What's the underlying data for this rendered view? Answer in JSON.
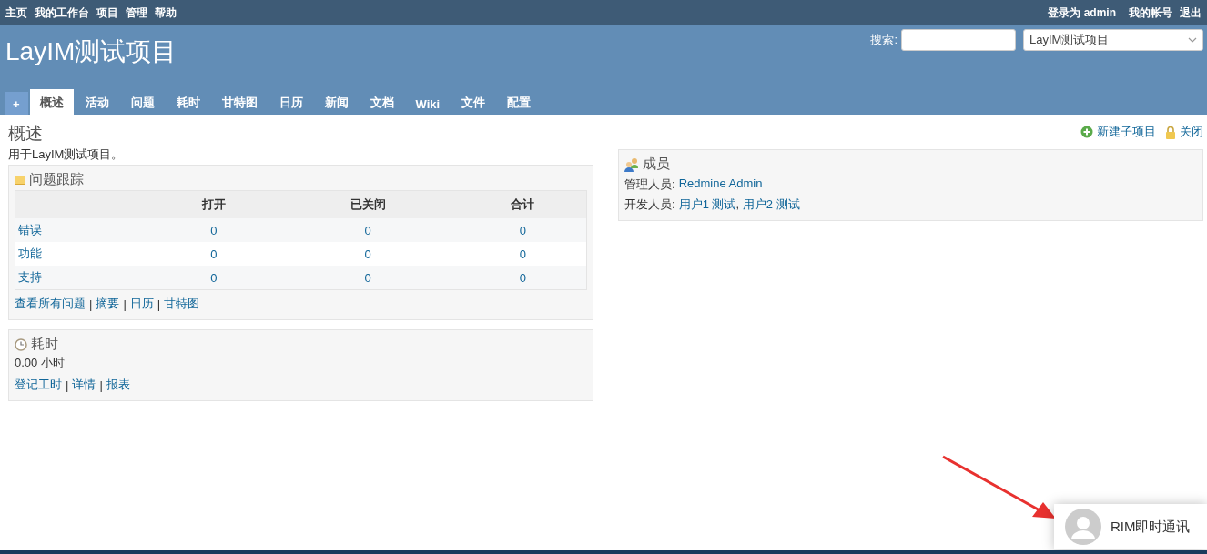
{
  "top_menu": {
    "left": [
      "主页",
      "我的工作台",
      "项目",
      "管理",
      "帮助"
    ],
    "logged_in": "登录为 admin",
    "right": [
      "我的帐号",
      "退出"
    ]
  },
  "header": {
    "title": "LayIM测试项目",
    "search_label": "搜索:",
    "project_select": "LayIM测试项目"
  },
  "tabs": [
    {
      "label": "+",
      "kind": "new",
      "selected": false
    },
    {
      "label": "概述",
      "kind": "tab",
      "selected": true
    },
    {
      "label": "活动",
      "kind": "tab",
      "selected": false
    },
    {
      "label": "问题",
      "kind": "tab",
      "selected": false
    },
    {
      "label": "耗时",
      "kind": "tab",
      "selected": false
    },
    {
      "label": "甘特图",
      "kind": "tab",
      "selected": false
    },
    {
      "label": "日历",
      "kind": "tab",
      "selected": false
    },
    {
      "label": "新闻",
      "kind": "tab",
      "selected": false
    },
    {
      "label": "文档",
      "kind": "tab",
      "selected": false
    },
    {
      "label": "Wiki",
      "kind": "tab",
      "selected": false
    },
    {
      "label": "文件",
      "kind": "tab",
      "selected": false
    },
    {
      "label": "配置",
      "kind": "tab",
      "selected": false
    }
  ],
  "page": {
    "title": "概述",
    "description": "用于LayIM测试项目。"
  },
  "actions": [
    {
      "label": "新建子项目",
      "kind": "add"
    },
    {
      "label": "关闭",
      "kind": "lock"
    }
  ],
  "issue_tracking": {
    "title": "问题跟踪",
    "columns": [
      "打开",
      "已关闭",
      "合计"
    ],
    "rows": [
      {
        "tracker": "错误",
        "values": [
          "0",
          "0",
          "0"
        ]
      },
      {
        "tracker": "功能",
        "values": [
          "0",
          "0",
          "0"
        ]
      },
      {
        "tracker": "支持",
        "values": [
          "0",
          "0",
          "0"
        ]
      }
    ],
    "links": [
      "查看所有问题",
      "摘要",
      "日历",
      "甘特图"
    ],
    "separator": "|"
  },
  "spent_time": {
    "title": "耗时",
    "value": "0.00 小时",
    "links": [
      "登记工时",
      "详情",
      "报表"
    ],
    "separator": "|"
  },
  "members": {
    "title": "成员",
    "groups": [
      {
        "role": "管理人员:",
        "users": [
          "Redmine Admin"
        ]
      },
      {
        "role": "开发人员:",
        "users": [
          "用户1 测试",
          "用户2 测试"
        ]
      }
    ],
    "separator": ","
  },
  "chat_widget": {
    "label": "RIM即时通讯"
  }
}
